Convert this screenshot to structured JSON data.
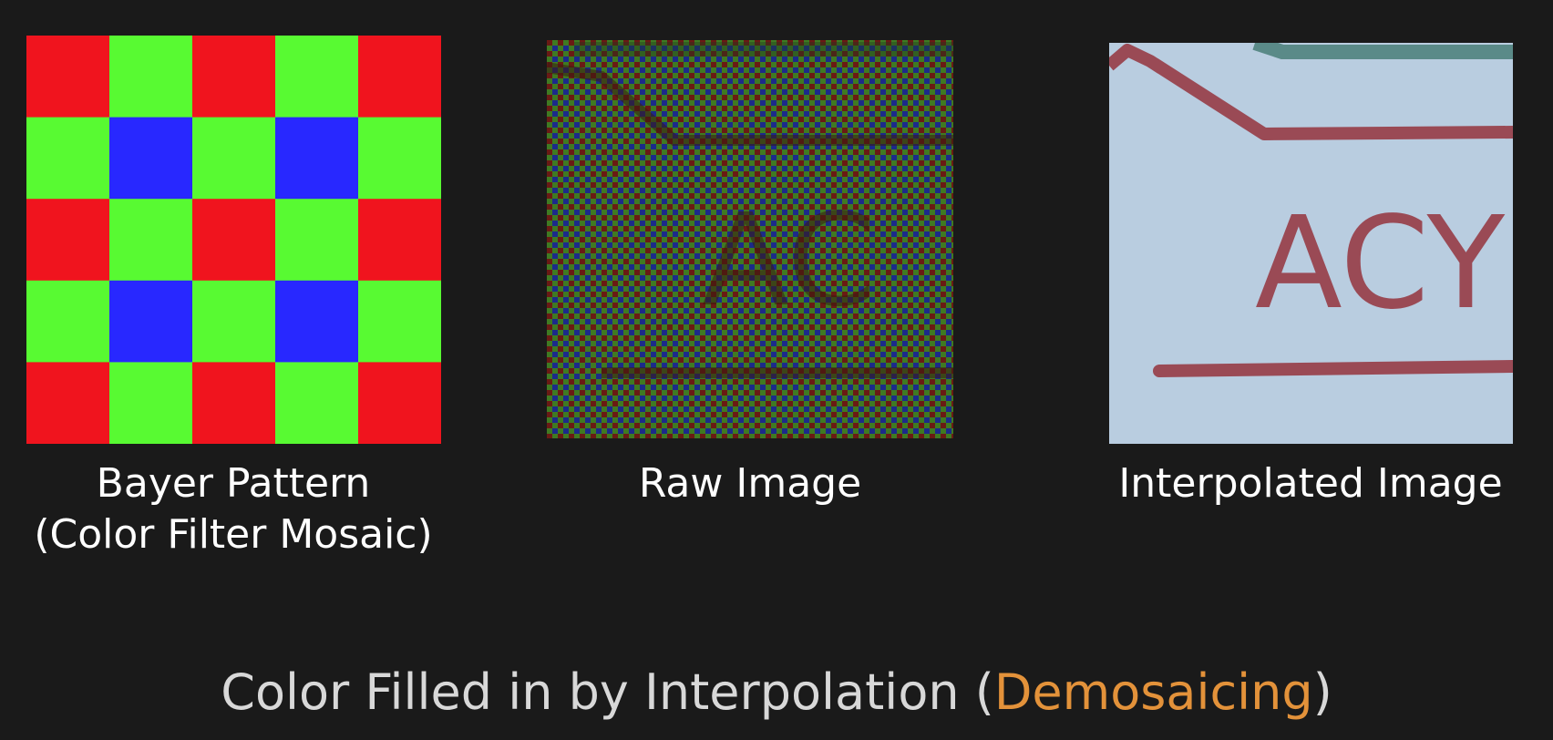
{
  "colors": {
    "background": "#1a1a1a",
    "bayer_red": "#f0141e",
    "bayer_green": "#58fa32",
    "bayer_blue": "#2828ff",
    "raw_red": "#6a1a14",
    "raw_green": "#3f7a22",
    "raw_blue": "#1c2a8a",
    "interp_background": "#b9cde0",
    "interp_ink": "#9a4a55",
    "interp_teal": "#5a8a88",
    "accent": "#e3923a",
    "footer_text": "#d8d8d8"
  },
  "panels": {
    "bayer": {
      "caption_line1": "Bayer Pattern",
      "caption_line2": "(Color Filter Mosaic)"
    },
    "raw": {
      "caption": "Raw Image",
      "ghost_text": "AC"
    },
    "interpolated": {
      "caption": "Interpolated Image",
      "ghost_text": "ACY"
    }
  },
  "footer": {
    "prefix": "Color Filled in by Interpolation (",
    "highlight": "Demosaicing",
    "suffix": ")"
  }
}
